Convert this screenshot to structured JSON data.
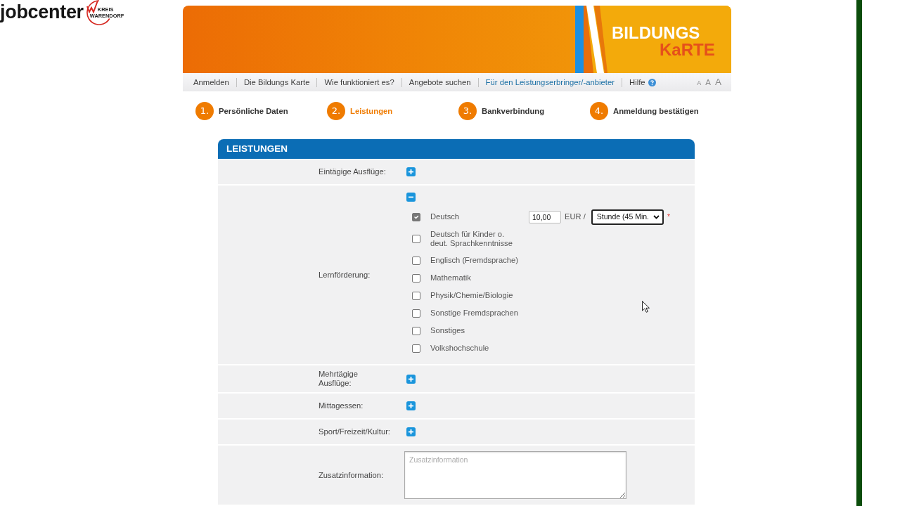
{
  "logo": {
    "name": "jobcenter",
    "emblem_lines": [
      "KREIS",
      "WARENDORF"
    ]
  },
  "banner": {
    "title_lines": [
      "BILDUNGS",
      "KaRTE"
    ]
  },
  "nav": {
    "items": [
      {
        "label": "Anmelden",
        "kind": "link",
        "selected": false
      },
      {
        "label": "Die Bildungs Karte",
        "kind": "link",
        "selected": false
      },
      {
        "label": "Wie funktioniert es?",
        "kind": "link",
        "selected": false
      },
      {
        "label": "Angebote suchen",
        "kind": "link",
        "selected": false
      },
      {
        "label": "Für den Leistungserbringer/-anbieter",
        "kind": "link",
        "selected": true
      },
      {
        "label": "Hilfe",
        "kind": "help",
        "selected": false
      }
    ],
    "font_size_options": [
      "A",
      "A",
      "A"
    ]
  },
  "steps": [
    {
      "number": "1.",
      "label": "Persönliche Daten",
      "selected": false
    },
    {
      "number": "2.",
      "label": "Leistungen",
      "selected": true
    },
    {
      "number": "3.",
      "label": "Bankverbindung",
      "selected": false
    },
    {
      "number": "4.",
      "label": "Anmeldung bestätigen",
      "selected": false
    }
  ],
  "section": {
    "title": "LEISTUNGEN",
    "rows": [
      {
        "kind": "toggle",
        "label": "Eintägige Ausflüge:",
        "expanded": false
      },
      {
        "kind": "toggle",
        "label": "Lernförderung:",
        "expanded": true,
        "options": [
          {
            "label": "Deutsch",
            "checked": true,
            "price": "10,00",
            "currency": "EUR /",
            "unit": "Stunde (45 Min.",
            "required_mark": "*"
          },
          {
            "label": "Deutsch für Kinder o. deut. Sprachkenntnisse",
            "checked": false
          },
          {
            "label": "Englisch (Fremdsprache)",
            "checked": false
          },
          {
            "label": "Mathematik",
            "checked": false
          },
          {
            "label": "Physik/Chemie/Biologie",
            "checked": false
          },
          {
            "label": "Sonstige Fremdsprachen",
            "checked": false
          },
          {
            "label": "Sonstiges",
            "checked": false
          },
          {
            "label": "Volkshochschule",
            "checked": false
          }
        ]
      },
      {
        "kind": "toggle",
        "label": "Mehrtägige Ausflüge:",
        "expanded": false
      },
      {
        "kind": "toggle",
        "label": "Mittagessen:",
        "expanded": false
      },
      {
        "kind": "toggle",
        "label": "Sport/Freizeit/Kultur:",
        "expanded": false
      },
      {
        "kind": "textarea",
        "label": "Zusatzinformation:",
        "placeholder": "Zusatzinformation"
      }
    ]
  }
}
